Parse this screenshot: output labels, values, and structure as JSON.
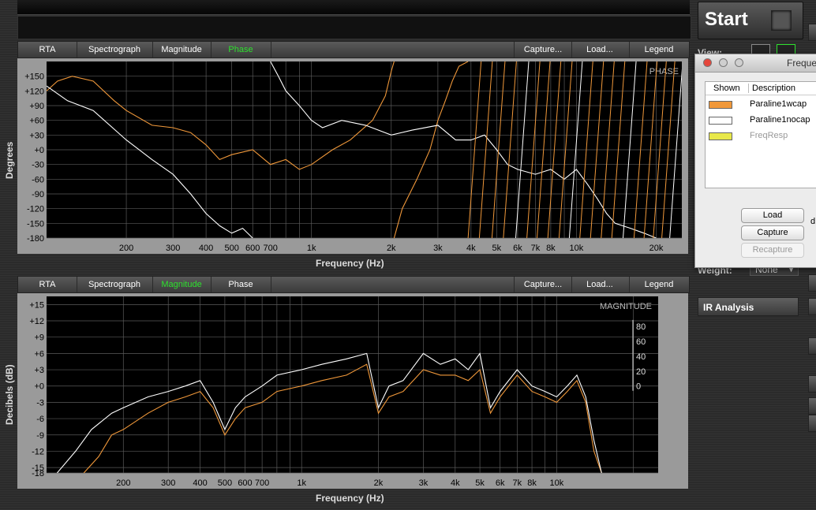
{
  "tabs_top": {
    "rta": "RTA",
    "spectrograph": "Spectrograph",
    "magnitude": "Magnitude",
    "phase": "Phase",
    "capture": "Capture...",
    "load": "Load...",
    "legend": "Legend"
  },
  "tabs_bottom": {
    "rta": "RTA",
    "spectrograph": "Spectrograph",
    "magnitude": "Magnitude",
    "phase": "Phase",
    "capture": "Capture...",
    "load": "Load...",
    "legend": "Legend"
  },
  "colors": {
    "series1": "#f0983a",
    "series2": "#ffffff",
    "series3": "#e8e84a",
    "accent_green": "#2ee12e",
    "plot_bg": "#000000",
    "grid": "#6a6a6a"
  },
  "start_button": {
    "label": "Start"
  },
  "view_label": "View:",
  "weight": {
    "label": "Weight:",
    "value": "None"
  },
  "ir_analysis": {
    "label": "IR Analysis"
  },
  "dialog": {
    "title": "Freque",
    "col_shown": "Shown",
    "col_description": "Description",
    "rows": [
      {
        "description": "Paraline1wcap",
        "color": "#f0983a"
      },
      {
        "description": "Paraline1nocap",
        "color": "#ffffff"
      },
      {
        "description": "FreqResp",
        "color": "#e8e84a"
      }
    ],
    "buttons": {
      "load": "Load",
      "capture": "Capture",
      "recapture": "Recapture"
    },
    "edge_letter": "d"
  },
  "chart_data": [
    {
      "type": "line",
      "title": "PHASE",
      "xlabel": "Frequency (Hz)",
      "ylabel": "Degrees",
      "xscale": "log",
      "xlim": [
        100,
        25000
      ],
      "ylim": [
        -180,
        180
      ],
      "x_ticks": [
        200,
        300,
        400,
        500,
        600,
        700,
        1000,
        2000,
        3000,
        4000,
        5000,
        6000,
        7000,
        8000,
        10000,
        20000
      ],
      "x_tick_labels": [
        "200",
        "300",
        "400",
        "500",
        "600",
        "700",
        "1k",
        "2k",
        "3k",
        "4k",
        "5k",
        "6k",
        "7k",
        "8k",
        "10k",
        "20k"
      ],
      "y_ticks": [
        150,
        120,
        90,
        60,
        30,
        0,
        -30,
        -60,
        -90,
        -120,
        -150,
        -180
      ],
      "y_tick_labels": [
        "+150",
        "+120",
        "+90",
        "+60",
        "+30",
        "+0",
        "-30",
        "-60",
        "-90",
        "-120",
        "-150",
        "-180"
      ],
      "grid": true,
      "series": [
        {
          "name": "Paraline1wcap",
          "x": [
            100,
            110,
            125,
            150,
            180,
            200,
            250,
            300,
            350,
            400,
            450,
            500,
            600,
            700,
            800,
            900,
            1000,
            1200,
            1400,
            1700,
            1900,
            2000,
            2050
          ],
          "y": [
            120,
            140,
            150,
            140,
            100,
            80,
            50,
            45,
            35,
            10,
            -20,
            -10,
            0,
            -30,
            -20,
            -40,
            -30,
            0,
            20,
            60,
            110,
            160,
            180
          ]
        },
        {
          "name": "Paraline1wcap",
          "x": [
            2050,
            2200,
            2500,
            2800,
            3000,
            3200,
            3400,
            3600,
            3900
          ],
          "y": [
            -180,
            -120,
            -60,
            0,
            60,
            100,
            140,
            170,
            180
          ]
        },
        {
          "name": "Paraline1nocap",
          "x": [
            100,
            120,
            150,
            200,
            250,
            300,
            350,
            400,
            450,
            500,
            550,
            600
          ],
          "y": [
            130,
            100,
            80,
            20,
            -20,
            -50,
            -90,
            -130,
            -155,
            -170,
            -160,
            -180
          ]
        },
        {
          "name": "Paraline1nocap",
          "x": [
            700,
            750,
            800,
            900,
            1000,
            1100,
            1300,
            1600,
            2000,
            2400,
            3000,
            3500,
            4000,
            4500,
            5000,
            5500,
            6000,
            7000,
            8000,
            9000,
            10000,
            11000,
            12000,
            13000,
            14000,
            16000,
            18000,
            20000
          ],
          "y": [
            180,
            150,
            120,
            90,
            60,
            45,
            60,
            50,
            30,
            40,
            50,
            20,
            20,
            30,
            0,
            -30,
            -40,
            -50,
            -40,
            -60,
            -40,
            -70,
            -100,
            -130,
            -150,
            -160,
            -170,
            -180
          ]
        }
      ]
    },
    {
      "type": "line",
      "title": "MAGNITUDE",
      "xlabel": "Frequency (Hz)",
      "ylabel": "Decibels (dB)",
      "xscale": "log",
      "xlim": [
        100,
        25000
      ],
      "ylim": [
        -16,
        16.5
      ],
      "x_ticks": [
        200,
        300,
        400,
        500,
        600,
        700,
        1000,
        2000,
        3000,
        4000,
        5000,
        6000,
        7000,
        8000,
        10000
      ],
      "x_tick_labels": [
        "200",
        "300",
        "400",
        "500",
        "600",
        "700",
        "1k",
        "2k",
        "3k",
        "4k",
        "5k",
        "6k",
        "7k",
        "8k",
        "10k"
      ],
      "y_ticks": [
        15,
        12,
        9,
        6,
        3,
        0,
        -3,
        -6,
        -9,
        -12,
        -15,
        -16
      ],
      "y_tick_labels": [
        "+15",
        "+12",
        "+9",
        "+6",
        "+3",
        "+0",
        "-3",
        "-6",
        "-9",
        "-12",
        "-15",
        "-18"
      ],
      "y2_ticks": [
        80,
        60,
        40,
        20,
        0
      ],
      "y2_tick_labels": [
        "80",
        "60",
        "40",
        "20",
        "0"
      ],
      "grid": true,
      "series": [
        {
          "name": "Paraline1wcap",
          "x": [
            140,
            160,
            180,
            200,
            250,
            300,
            350,
            400,
            450,
            500,
            550,
            600,
            700,
            800,
            1000,
            1200,
            1500,
            1800,
            2000,
            2200,
            2500,
            3000,
            3500,
            4000,
            4500,
            5000,
            5500,
            6000,
            7000,
            8000,
            9000,
            10000,
            11000,
            12000,
            13000,
            14000,
            15000
          ],
          "y": [
            -16,
            -13,
            -9,
            -8,
            -5,
            -3,
            -2,
            -1,
            -4,
            -9,
            -6,
            -4,
            -3,
            -1,
            0,
            1,
            2,
            4,
            -5,
            -2,
            -1,
            3,
            2,
            2,
            1,
            3,
            -5,
            -2,
            2,
            -1,
            -2,
            -3,
            -1,
            1,
            -3,
            -12,
            -16
          ]
        },
        {
          "name": "Paraline1nocap",
          "x": [
            110,
            130,
            150,
            180,
            200,
            250,
            300,
            350,
            400,
            450,
            500,
            550,
            600,
            700,
            800,
            1000,
            1200,
            1500,
            1800,
            2000,
            2200,
            2500,
            3000,
            3500,
            4000,
            4500,
            5000,
            5500,
            6000,
            7000,
            8000,
            9000,
            10000,
            11000,
            12000,
            13000,
            14000,
            15000
          ],
          "y": [
            -16,
            -12,
            -8,
            -5,
            -4,
            -2,
            -1,
            0,
            1,
            -3,
            -8,
            -4,
            -2,
            0,
            2,
            3,
            4,
            5,
            6,
            -4,
            0,
            1,
            6,
            4,
            5,
            3,
            6,
            -4,
            -1,
            3,
            0,
            -1,
            -2,
            0,
            2,
            -2,
            -10,
            -16
          ]
        }
      ]
    }
  ]
}
